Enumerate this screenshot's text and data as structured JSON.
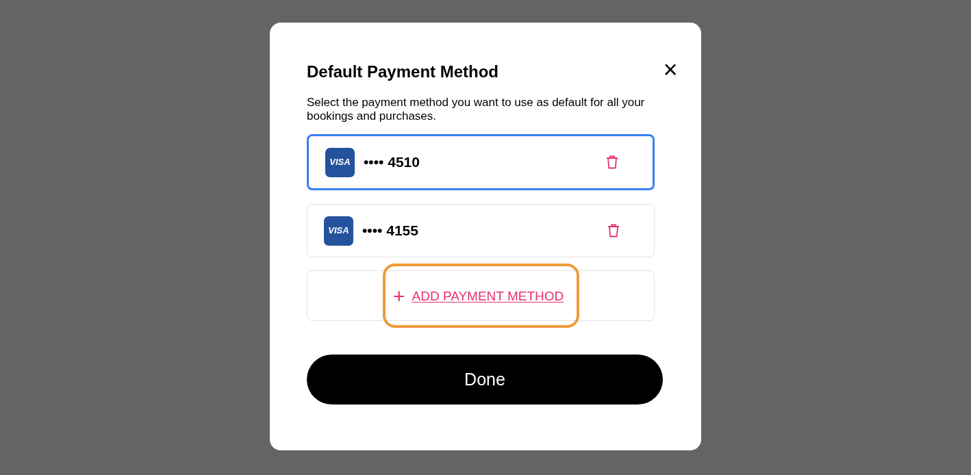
{
  "dialog": {
    "title": "Default Payment Method",
    "close": "×",
    "description": "Select the payment method you want to use as default for all your bookings and purchases."
  },
  "cards": [
    {
      "brand": "VISA",
      "mask": "••••",
      "last4": "4510",
      "selected": true
    },
    {
      "brand": "VISA",
      "mask": "••••",
      "last4": "4155",
      "selected": false
    }
  ],
  "add_button": {
    "icon": "+",
    "label": "ADD PAYMENT METHOD",
    "highlighted": true
  },
  "done_button": "Done"
}
